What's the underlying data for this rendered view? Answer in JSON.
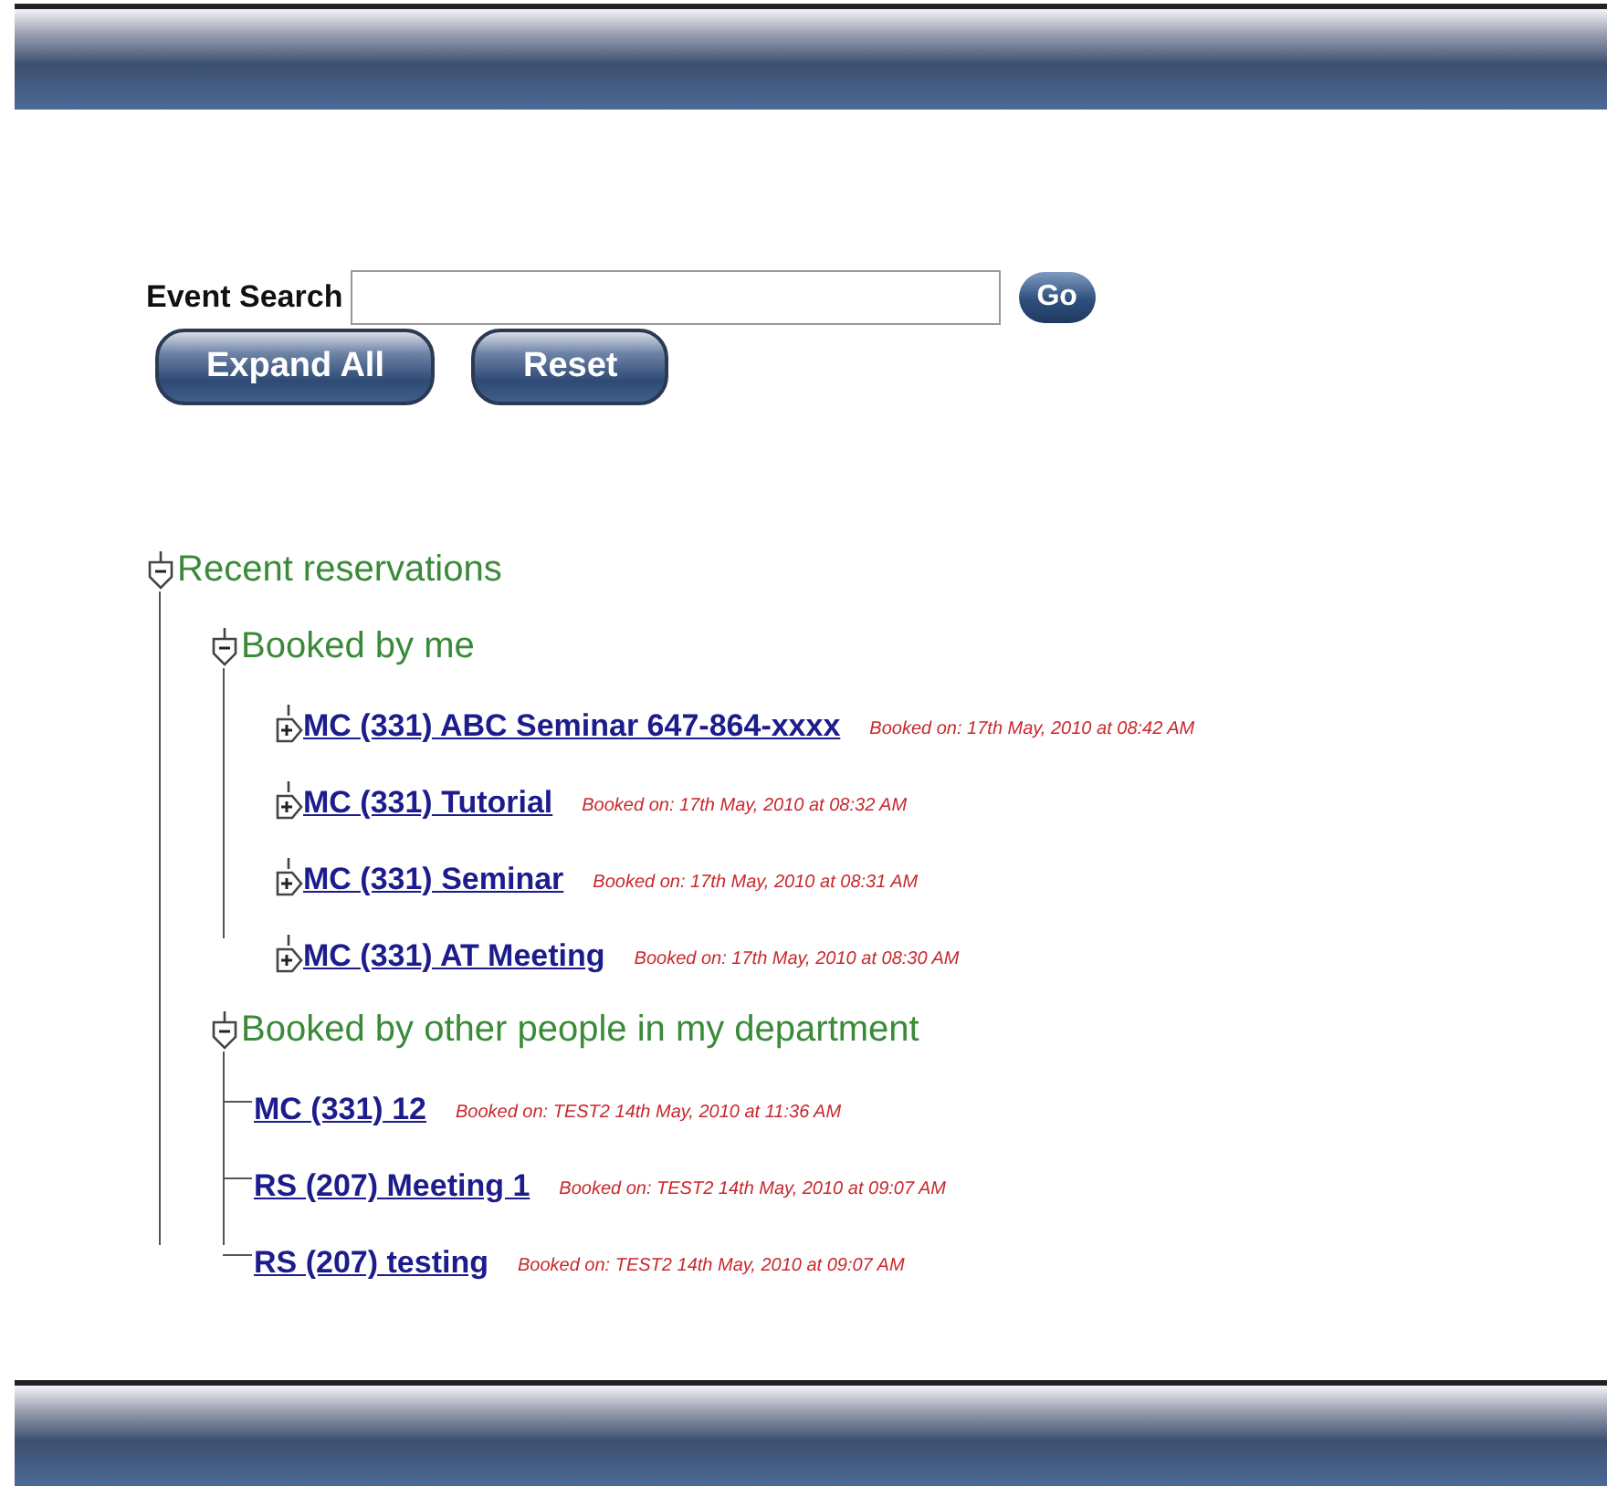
{
  "search": {
    "label": "Event Search",
    "go": "Go"
  },
  "buttons": [
    "Expand All",
    "Reset"
  ],
  "tree": [
    {
      "label": "Recent reservations",
      "expanded": true,
      "children": [
        {
          "label": "Booked by me",
          "expanded": true,
          "children": [
            {
              "label": "MC (331) ABC Seminar 647-864-xxxx",
              "booked": "Booked on: 17th May, 2010 at 08:42 AM",
              "expanded": false
            },
            {
              "label": "MC (331) Tutorial",
              "booked": "Booked on: 17th May, 2010 at 08:32 AM",
              "expanded": false
            },
            {
              "label": "MC (331) Seminar",
              "booked": "Booked on: 17th May, 2010 at 08:31 AM",
              "expanded": false
            },
            {
              "label": "MC (331) AT Meeting",
              "booked": "Booked on: 17th May, 2010 at 08:30 AM",
              "expanded": false
            }
          ]
        },
        {
          "label": "Booked by other people in my department",
          "expanded": true,
          "children": [
            {
              "label": "MC (331) 12",
              "booked": "Booked on: TEST2 14th May, 2010 at 11:36 AM"
            },
            {
              "label": "RS (207) Meeting 1",
              "booked": "Booked on: TEST2 14th May, 2010 at 09:07 AM"
            },
            {
              "label": "RS (207) testing",
              "booked": "Booked on: TEST2 14th May, 2010 at 09:07 AM"
            }
          ]
        }
      ]
    }
  ]
}
